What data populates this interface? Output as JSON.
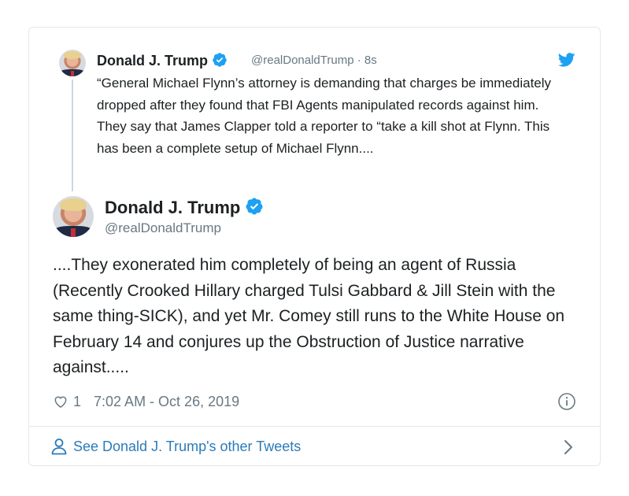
{
  "quoted_tweet": {
    "author_name": "Donald J. Trump",
    "handle": "@realDonaldTrump",
    "separator": "·",
    "time_ago": "8s",
    "text": "“General Michael Flynn’s attorney is demanding that charges be immediately dropped after they found that FBI Agents manipulated records against him. They say that James Clapper told a reporter to “take a kill shot at Flynn. This has been a complete setup of Michael Flynn...."
  },
  "main_tweet": {
    "author_name": "Donald J. Trump",
    "handle": "@realDonaldTrump",
    "text": "....They exonerated him completely of being an agent of Russia (Recently Crooked Hillary charged Tulsi Gabbard & Jill Stein with the same thing-SICK), and yet Mr. Comey still runs to the White House on February 14 and conjures up the Obstruction of Justice narrative against.....",
    "like_count": "1",
    "timestamp": "7:02 AM - Oct 26, 2019"
  },
  "footer": {
    "link_label": "See Donald J. Trump's other Tweets"
  },
  "icons": {
    "verified": "verified-badge-icon",
    "bird": "twitter-bird-icon",
    "heart": "heart-icon",
    "info": "info-icon",
    "person": "person-icon",
    "chevron": "chevron-right-icon"
  },
  "colors": {
    "twitter_blue": "#1da1f2",
    "link_blue": "#2b7bb9",
    "muted_text": "#697882",
    "border": "#e1e8ed"
  }
}
